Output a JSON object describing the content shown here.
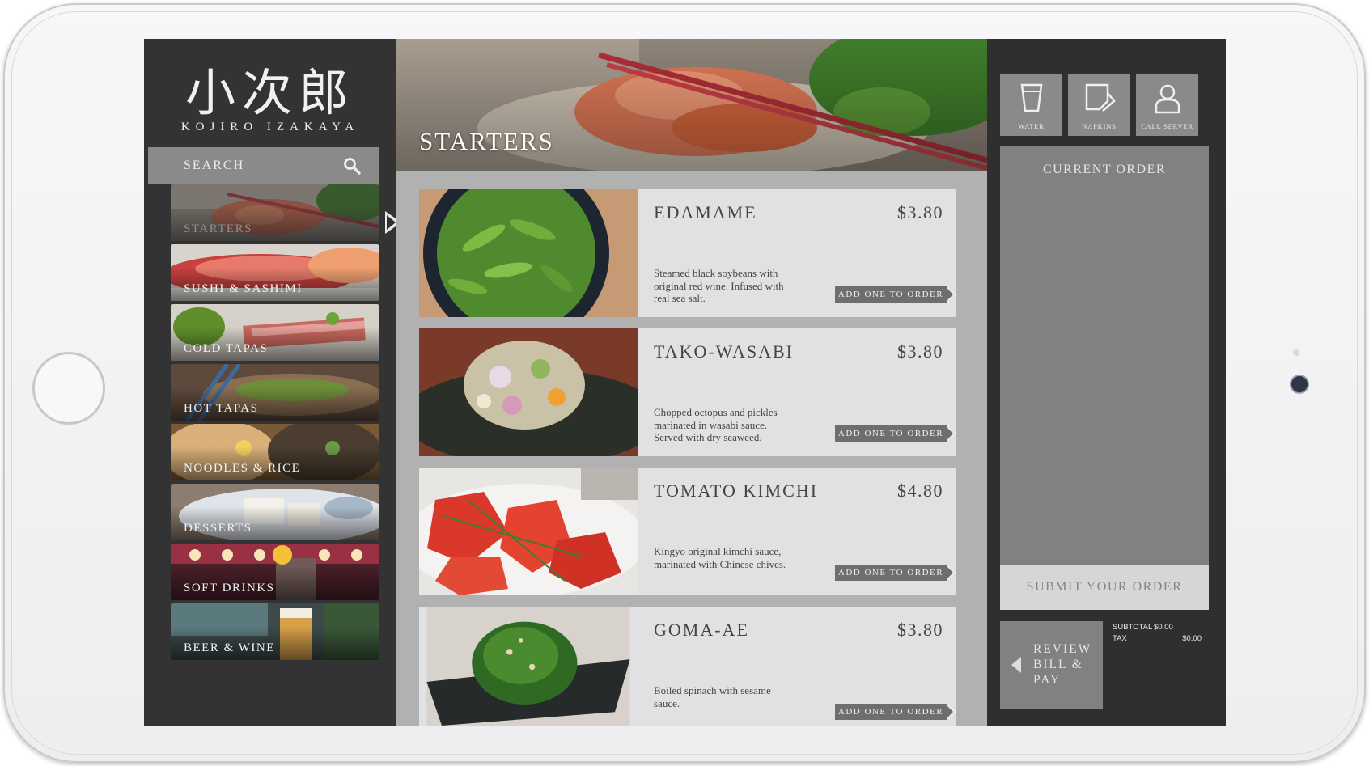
{
  "app": {
    "logo_kanji": "小次郎",
    "logo_sub": "KOJIRO IZAKAYA"
  },
  "search": {
    "placeholder": "SEARCH"
  },
  "categories": [
    {
      "label": "STARTERS",
      "active": true
    },
    {
      "label": "SUSHI & SASHIMI"
    },
    {
      "label": "COLD TAPAS"
    },
    {
      "label": "HOT TAPAS"
    },
    {
      "label": "NOODLES & RICE"
    },
    {
      "label": "DESSERTS"
    },
    {
      "label": "SOFT DRINKS"
    },
    {
      "label": "BEER & WINE"
    }
  ],
  "section": {
    "title": "STARTERS"
  },
  "menu_items": [
    {
      "name": "EDAMAME",
      "price": "$3.80",
      "description": "Steamed black soybeans with original red wine. Infused with real sea salt.",
      "button": "ADD ONE TO ORDER"
    },
    {
      "name": "TAKO-WASABI",
      "price": "$3.80",
      "description": "Chopped octopus and pickles marinated in wasabi sauce. Served with dry seaweed.",
      "button": "ADD ONE TO ORDER"
    },
    {
      "name": "TOMATO KIMCHI",
      "price": "$4.80",
      "description": "Kingyo original kimchi sauce, marinated with Chinese chives.",
      "button": "ADD ONE TO ORDER"
    },
    {
      "name": "GOMA-AE",
      "price": "$3.80",
      "description": "Boiled spinach with sesame sauce.",
      "button": "ADD ONE TO ORDER"
    }
  ],
  "service_buttons": [
    {
      "label": "WATER",
      "icon": "water-glass-icon"
    },
    {
      "label": "NAPKINS",
      "icon": "napkin-icon"
    },
    {
      "label": "CALL SERVER",
      "icon": "person-icon"
    }
  ],
  "order": {
    "title": "CURRENT ORDER",
    "submit_label": "SUBMIT YOUR ORDER",
    "review_label": "REVIEW BILL & PAY",
    "subtotal_label": "SUBTOTAL",
    "subtotal_value": "$0.00",
    "tax_label": "TAX",
    "tax_value": "$0.00"
  },
  "colors": {
    "screen_bg": "#2f2f2f",
    "panel_gray": "#818181",
    "card_bg": "#e1e1e3",
    "button_gray": "#6e6e6e"
  }
}
